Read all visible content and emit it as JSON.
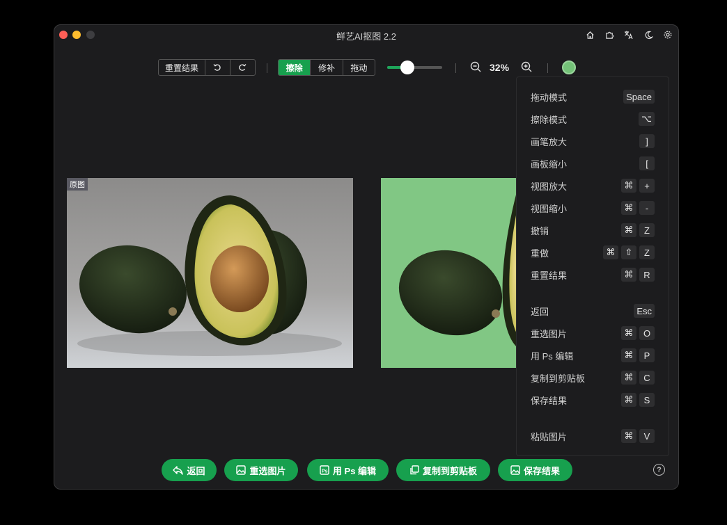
{
  "window": {
    "title": "鲜艺AI抠图 2.2"
  },
  "title_icons": [
    "home-icon",
    "puzzle-icon",
    "translate-icon",
    "moon-icon",
    "gear-icon"
  ],
  "toolbar": {
    "reset_label": "重置结果",
    "undo_icon": "undo-icon",
    "redo_icon": "redo-icon",
    "modes": [
      "擦除",
      "修补",
      "拖动"
    ],
    "active_mode": "擦除",
    "brush_size_fraction": 0.37,
    "zoom": "32%",
    "bg_color": "#74c278"
  },
  "images": {
    "original_tag": "原图"
  },
  "shortcuts": [
    {
      "label": "拖动模式",
      "keys": [
        "Space"
      ]
    },
    {
      "label": "擦除模式",
      "keys": [
        "⌥"
      ]
    },
    {
      "label": "画笔放大",
      "keys": [
        "]"
      ]
    },
    {
      "label": "画板缩小",
      "keys": [
        "["
      ]
    },
    {
      "label": "视图放大",
      "keys": [
        "⌘",
        "+"
      ]
    },
    {
      "label": "视图缩小",
      "keys": [
        "⌘",
        "-"
      ]
    },
    {
      "label": "撤销",
      "keys": [
        "⌘",
        "Z"
      ]
    },
    {
      "label": "重做",
      "keys": [
        "⌘",
        "⇧",
        "Z"
      ]
    },
    {
      "label": "重置结果",
      "keys": [
        "⌘",
        "R"
      ]
    },
    {
      "label": "返回",
      "keys": [
        "Esc"
      ]
    },
    {
      "label": "重选图片",
      "keys": [
        "⌘",
        "O"
      ]
    },
    {
      "label": "用 Ps 编辑",
      "keys": [
        "⌘",
        "P"
      ]
    },
    {
      "label": "复制到剪贴板",
      "keys": [
        "⌘",
        "C"
      ]
    },
    {
      "label": "保存结果",
      "keys": [
        "⌘",
        "S"
      ]
    },
    {
      "label": "粘贴图片",
      "keys": [
        "⌘",
        "V"
      ]
    }
  ],
  "bottom": {
    "back": "返回",
    "reselect": "重选图片",
    "ps_edit": "用 Ps 编辑",
    "copy": "复制到剪贴板",
    "save": "保存结果",
    "help": "?"
  },
  "colors": {
    "accent": "#17a04e",
    "result_bg": "#81c784"
  }
}
